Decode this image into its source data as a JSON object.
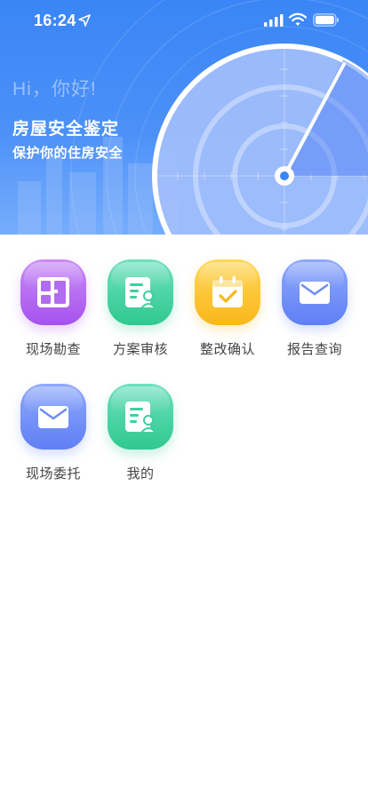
{
  "status_bar": {
    "time": "16:24"
  },
  "header": {
    "greeting": "Hi，你好!",
    "title": "房屋安全鉴定",
    "subtitle": "保护你的住房安全"
  },
  "menu": {
    "items": [
      {
        "label": "现场勘查",
        "icon": "floorplan-icon",
        "color": "#a552ee"
      },
      {
        "label": "方案审核",
        "icon": "document-person-icon",
        "color": "#2fc891"
      },
      {
        "label": "整改确认",
        "icon": "calendar-check-icon",
        "color": "#f9b71a"
      },
      {
        "label": "报告查询",
        "icon": "envelope-icon",
        "color": "#5f7ff5"
      },
      {
        "label": "现场委托",
        "icon": "envelope-icon",
        "color": "#5f7ff5"
      },
      {
        "label": "我的",
        "icon": "document-person-icon",
        "color": "#2fc891"
      }
    ]
  }
}
